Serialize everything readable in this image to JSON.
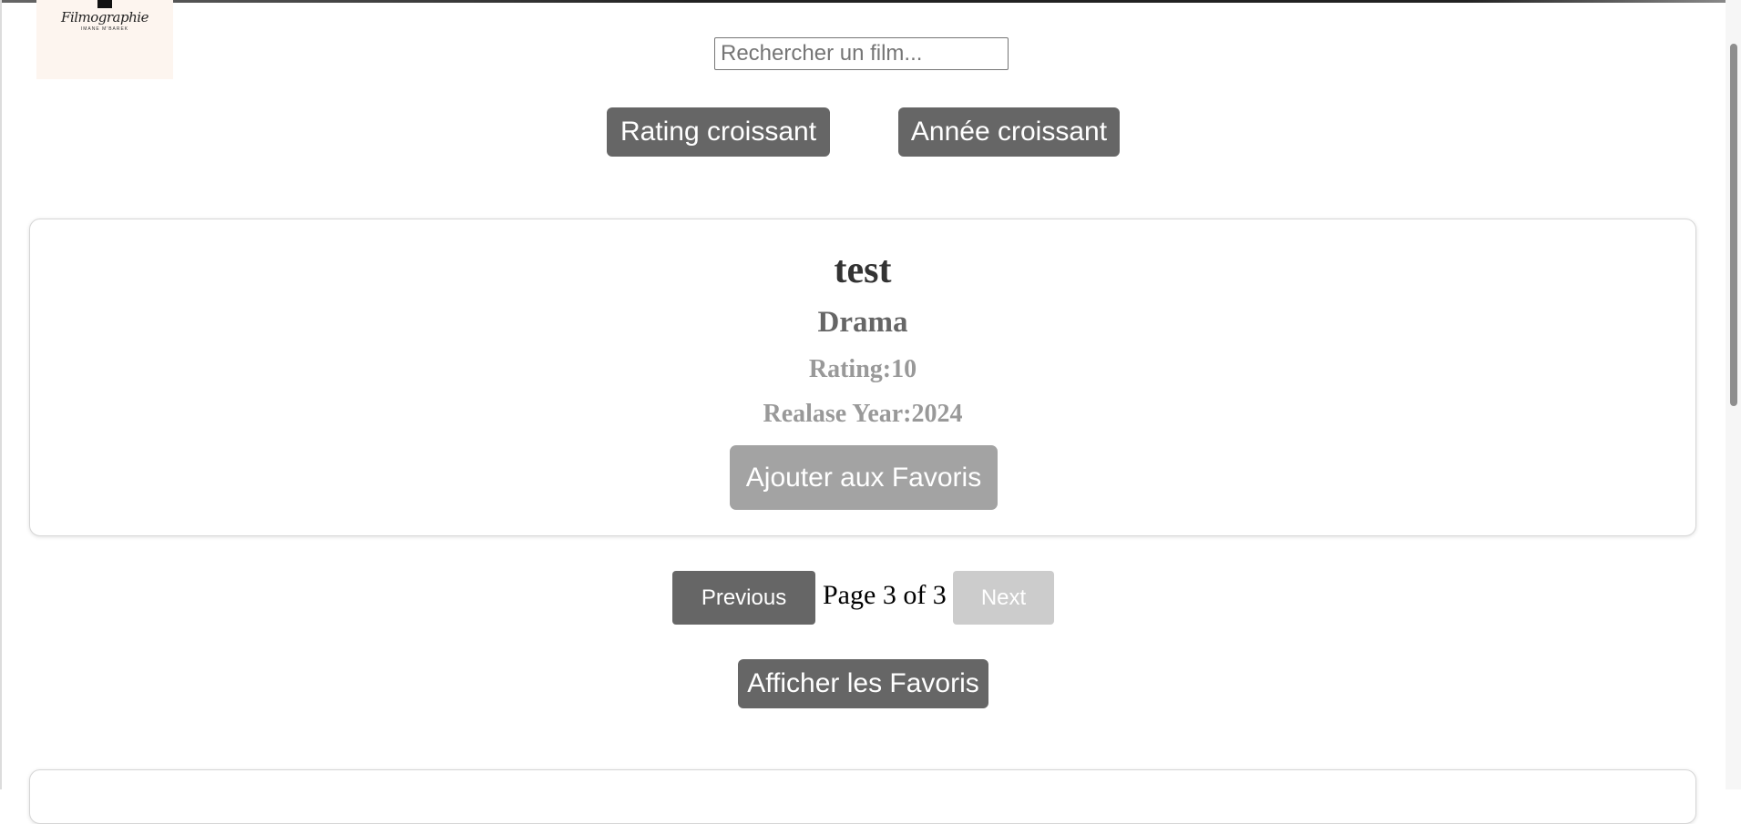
{
  "logo": {
    "script_text": "Filmographie",
    "subtitle": "IMANE M'BAREK"
  },
  "search": {
    "placeholder": "Rechercher un film...",
    "value": ""
  },
  "sort": {
    "rating_label": "Rating croissant",
    "year_label": "Année croissant"
  },
  "movie": {
    "title": "test",
    "genre": "Drama",
    "rating": "Rating:10",
    "year": "Realase Year:2024",
    "fav_button": "Ajouter aux Favoris"
  },
  "pagination": {
    "previous_label": "Previous",
    "page_info": "Page 3 of 3",
    "next_label": "Next"
  },
  "favorites": {
    "show_label": "Afficher les Favoris"
  },
  "colors": {
    "button_bg": "#666666",
    "button_disabled_bg": "#cccccc",
    "fav_button_bg": "#a3a3a3",
    "logo_bg": "#fdf5ef"
  }
}
